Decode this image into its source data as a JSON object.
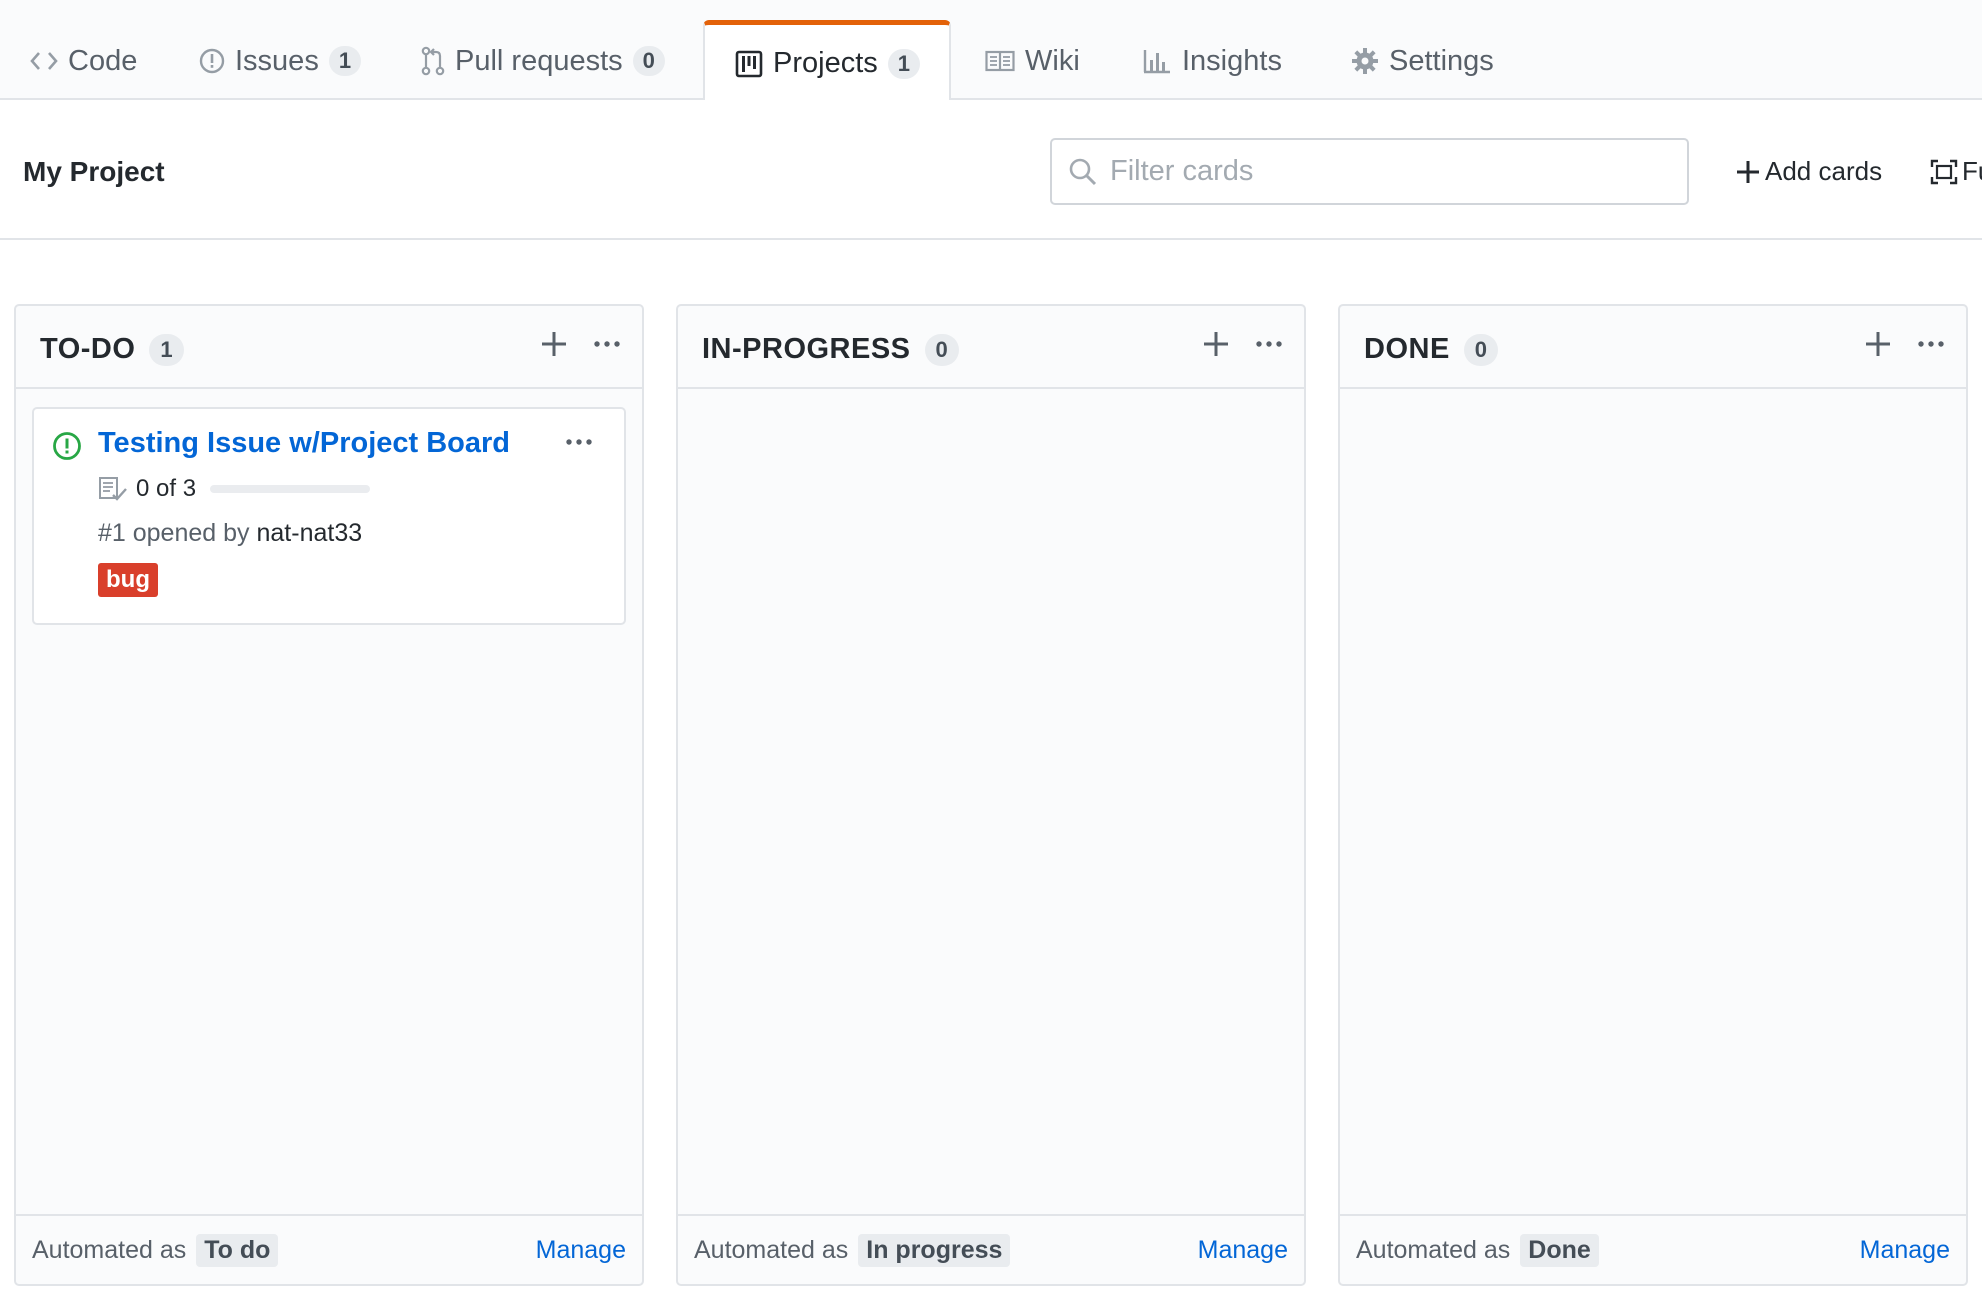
{
  "nav": {
    "tabs": [
      {
        "label": "Code",
        "icon": "code-icon"
      },
      {
        "label": "Issues",
        "count": "1",
        "icon": "issue-opened-icon"
      },
      {
        "label": "Pull requests",
        "count": "0",
        "icon": "git-pull-request-icon"
      },
      {
        "label": "Projects",
        "count": "1",
        "icon": "project-icon",
        "selected": true
      },
      {
        "label": "Wiki",
        "icon": "book-icon"
      },
      {
        "label": "Insights",
        "icon": "graph-icon"
      },
      {
        "label": "Settings",
        "icon": "gear-icon"
      }
    ]
  },
  "project": {
    "title": "My Project",
    "filter_placeholder": "Filter cards",
    "add_cards_label": "Add cards",
    "fullscreen_label": "Fu"
  },
  "columns": [
    {
      "title": "TO-DO",
      "count": "1",
      "automated_label": "Automated as",
      "stage": "To do",
      "manage_label": "Manage",
      "cards": [
        {
          "title": "Testing Issue w/Project Board",
          "tasks": "0 of 3",
          "tasks_done": 0,
          "tasks_total": 3,
          "meta_prefix": "#1 opened by",
          "author": "nat-nat33",
          "label": "bug",
          "label_color": "#d93f2b"
        }
      ]
    },
    {
      "title": "IN-PROGRESS",
      "count": "0",
      "automated_label": "Automated as",
      "stage": "In progress",
      "manage_label": "Manage",
      "cards": []
    },
    {
      "title": "DONE",
      "count": "0",
      "automated_label": "Automated as",
      "stage": "Done",
      "manage_label": "Manage",
      "cards": []
    }
  ],
  "colors": {
    "accent_tab": "#e36209",
    "link": "#0366d6",
    "issue_open": "#28a745",
    "label_bug": "#d93f2b"
  }
}
